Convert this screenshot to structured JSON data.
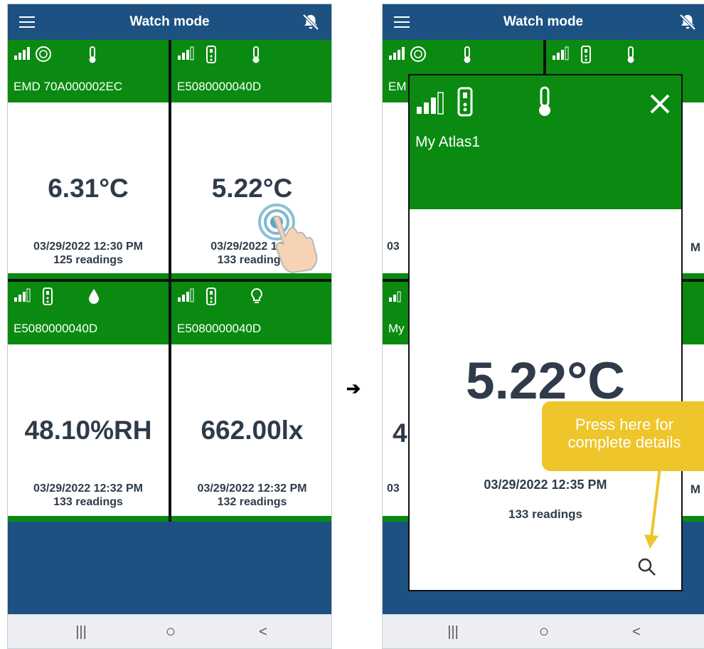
{
  "left_phone": {
    "title": "Watch mode",
    "tiles": [
      {
        "device": "EMD 70A000002EC",
        "reading": "6.31°C",
        "timestamp": "03/29/2022 12:30 PM",
        "count": "125 readings",
        "type_icon": "thermometer-icon",
        "device_icon": "sensor-round-icon"
      },
      {
        "device": "E5080000040D",
        "reading": "5.22°C",
        "timestamp": "03/29/2022 12:3",
        "count": "133 readings",
        "type_icon": "thermometer-icon",
        "device_icon": "logger-icon"
      },
      {
        "device": "E5080000040D",
        "reading": "48.10%RH",
        "timestamp": "03/29/2022 12:32 PM",
        "count": "133 readings",
        "type_icon": "humidity-drop-icon",
        "device_icon": "logger-icon"
      },
      {
        "device": "E5080000040D",
        "reading": "662.00lx",
        "timestamp": "03/29/2022 12:32 PM",
        "count": "132 readings",
        "type_icon": "light-bulb-icon",
        "device_icon": "logger-icon"
      }
    ]
  },
  "arrow": "➔",
  "right_phone": {
    "title": "Watch mode",
    "partial_tiles": {
      "t1_label": "EM",
      "t3_label": "My",
      "t1_ts": "03",
      "t2_ts": "M",
      "t3_ts": "03",
      "t4_ts": "M",
      "t3_reading": "4"
    },
    "popup": {
      "name": "My Atlas1",
      "reading": "5.22°C",
      "timestamp": "03/29/2022 12:35 PM",
      "count": "133 readings"
    },
    "callout": {
      "line1": "Press here for",
      "line2": "complete details"
    }
  },
  "navbar": {
    "recent": "|||",
    "home": "○",
    "back": "<"
  },
  "colors": {
    "header_blue": "#1c5182",
    "tile_green": "#0a8a10",
    "callout": "#eec52a",
    "text": "#2f3b4a"
  }
}
